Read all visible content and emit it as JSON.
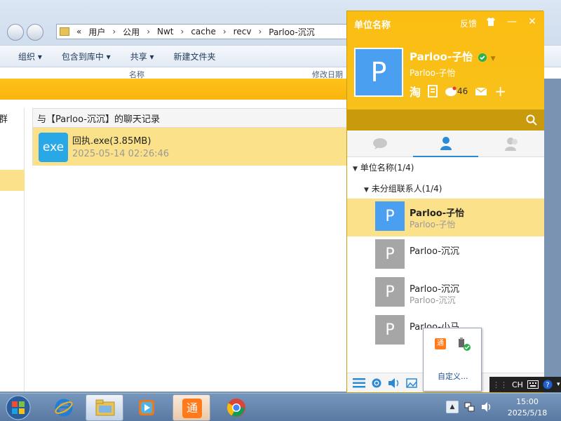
{
  "explorer": {
    "path": [
      "用户",
      "公用",
      "Nwt",
      "cache",
      "recv",
      "Parloo-沉沉"
    ],
    "path_prefix": "«",
    "toolbar": [
      "组织 ▾",
      "包含到库中 ▾",
      "共享 ▾",
      "新建文件夹"
    ],
    "columns": [
      "名称",
      "修改日期"
    ]
  },
  "chat": {
    "group_label": "群",
    "history_title": "与【Parloo-沉沉】的聊天记录",
    "file": {
      "icon_text": "exe",
      "name": "回执.exe(3.85MB)",
      "date": "2025-05-14 02:26:46"
    }
  },
  "panel": {
    "title": "单位名称",
    "feedback": "反馈",
    "user": {
      "avatar_letter": "P",
      "name": "Parloo-子怡",
      "signature": "Parloo-子怡",
      "mail_count": "46"
    },
    "tree": {
      "group": "单位名称(1/4)",
      "subgroup": "未分组联系人(1/4)",
      "contacts": [
        {
          "letter": "P",
          "name": "Parloo-子怡",
          "sig": "Parloo-子怡"
        },
        {
          "letter": "P",
          "name": "Parloo-沉沉",
          "sig": ""
        },
        {
          "letter": "P",
          "name": "Parloo-沉沉",
          "sig": "Parloo-沉沉"
        },
        {
          "letter": "P",
          "name": "Parloo-小马",
          "sig": ""
        }
      ]
    }
  },
  "tray_popup": {
    "customize": "自定义..."
  },
  "ime": {
    "lang": "CH"
  },
  "taskbar": {
    "time": "15:00",
    "date": "2025/5/18"
  },
  "colors": {
    "accent": "#f9b40e",
    "selected": "#fbe28a",
    "online": "#2bb24c"
  }
}
